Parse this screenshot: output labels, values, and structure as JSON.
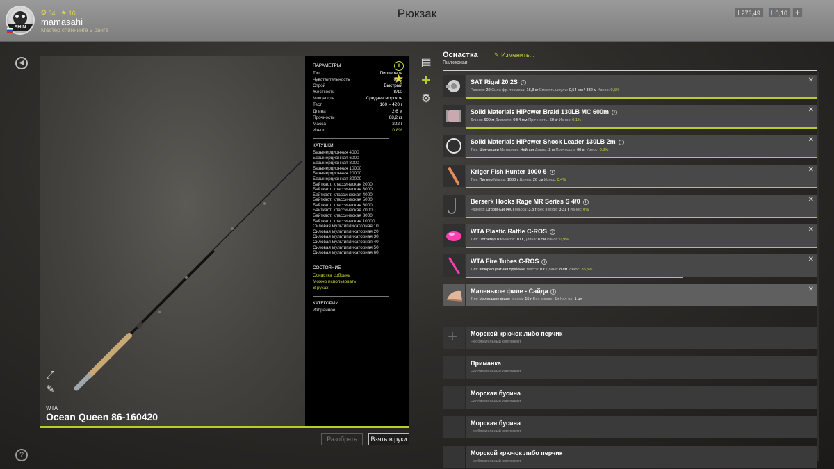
{
  "header": {
    "title": "Рюкзак",
    "user": {
      "name": "mamasahi",
      "subtitle": "Мастер спиннинга 2 ранга",
      "level": "34",
      "stars": "16",
      "avatar_text": "SHIN"
    },
    "currency": [
      {
        "icon": "silver-coin-icon",
        "value": "273,49"
      },
      {
        "icon": "gold-coin-icon",
        "value": "0,10"
      }
    ],
    "plus_label": "+"
  },
  "rod": {
    "brand": "WTA",
    "name": "Ocean Queen 86-160420",
    "durability_percent": 100,
    "params_title": "ПАРАМЕТРЫ",
    "params": [
      {
        "label": "Тип",
        "value": "Пилкерное"
      },
      {
        "label": "Чувствительность",
        "value": "6/10"
      },
      {
        "label": "Строй",
        "value": "Быстрый"
      },
      {
        "label": "Жёсткость",
        "value": "8/10"
      },
      {
        "label": "Мощность",
        "value": "Среднее морское"
      },
      {
        "label": "Тест",
        "value": "160 – 420 г"
      },
      {
        "label": "Длина",
        "value": "2,6 м"
      },
      {
        "label": "Прочность",
        "value": "68,2 кг"
      },
      {
        "label": "Масса",
        "value": "202 г"
      },
      {
        "label": "Износ",
        "value": "0,8%"
      }
    ],
    "reels_title": "КАТУШКИ",
    "reels": [
      "Безынерционная 4000",
      "Безынерционная 6000",
      "Безынерционная 8000",
      "Безынерционная 10000",
      "Безынерционная 20000",
      "Безынерционная 30000",
      "Байткаст. классическая 2000",
      "Байткаст. классическая 3000",
      "Байткаст. классическая 4000",
      "Байткаст. классическая 5000",
      "Байткаст. классическая 6000",
      "Байткаст. классическая 7000",
      "Байткаст. классическая 8000",
      "Байткаст. классическая 10000",
      "Силовая мультипликаторная 10",
      "Силовая мультипликаторная 20",
      "Силовая мультипликаторная 30",
      "Силовая мультипликаторная 40",
      "Силовая мультипликаторная 50",
      "Силовая мультипликаторная 60"
    ],
    "state_title": "СОСТОЯНИЕ",
    "states": [
      "Оснастка собрана",
      "Можно использовать",
      "В руках"
    ],
    "categories_title": "КАТЕГОРИИ",
    "categories": [
      "Избранное"
    ],
    "buttons": {
      "disassemble": "Разобрать",
      "take": "Взять в руки"
    }
  },
  "tackle": {
    "title": "Оснастка",
    "subtitle": "Пилкерная",
    "edit_label": "Изменить...",
    "items": [
      {
        "name": "SAT Rigal 20 2S",
        "icon": "reel-icon",
        "wear": 1.0,
        "details": [
          [
            "Размер:",
            "20"
          ],
          [
            "Сила фр. тормоза:",
            "16,3 кг"
          ],
          [
            "Ёмкость шпули:",
            "0,54 мм / 332 м"
          ],
          [
            "Износ:",
            "0,5%"
          ]
        ]
      },
      {
        "name": "Solid Materials HiPower Braid 130LB MC 600m",
        "icon": "braid-spool-icon",
        "wear": 1.0,
        "details": [
          [
            "Длина:",
            "600 м"
          ],
          [
            "Диаметр:",
            "0,54 мм"
          ],
          [
            "Прочность:",
            "60 кг"
          ],
          [
            "Износ:",
            "0,1%"
          ]
        ]
      },
      {
        "name": "Solid Materials HiPower Shock Leader 130LB 2m",
        "icon": "leader-coil-icon",
        "wear": 1.0,
        "details": [
          [
            "Тип:",
            "Шок-лидер"
          ],
          [
            "Материал:",
            "Нейлон"
          ],
          [
            "Длина:",
            "2 м"
          ],
          [
            "Прочность:",
            "60 кг"
          ],
          [
            "Износ:",
            "0,8%"
          ]
        ]
      },
      {
        "name": "Kriger Fish Hunter 1000-5",
        "icon": "pilker-icon",
        "wear": 1.0,
        "details": [
          [
            "Тип:",
            "Пилкер"
          ],
          [
            "Масса:",
            "1000 г"
          ],
          [
            "Длина:",
            "26 см"
          ],
          [
            "Износ:",
            "0,4%"
          ]
        ]
      },
      {
        "name": "Berserk Hooks Rage MR Series S 4/0",
        "icon": "hook-icon",
        "wear": 1.0,
        "details": [
          [
            "Размер:",
            "Огромный (4/0)"
          ],
          [
            "Масса:",
            "3,8 г"
          ],
          [
            "Вес в воде:",
            "3,31 г"
          ],
          [
            "Износ:",
            "0%"
          ]
        ]
      },
      {
        "name": "WTA Plastic Rattle C-ROS",
        "icon": "rattle-icon",
        "wear": 1.0,
        "details": [
          [
            "Тип:",
            "Погремушка"
          ],
          [
            "Масса:",
            "10 г"
          ],
          [
            "Длина:",
            "8 см"
          ],
          [
            "Износ:",
            "0,9%"
          ]
        ]
      },
      {
        "name": "WTA Fire Tubes C-ROS",
        "icon": "fire-tube-icon",
        "wear": 0.62,
        "details": [
          [
            "Тип:",
            "Флюресцентная трубочка"
          ],
          [
            "Масса:",
            "0 г"
          ],
          [
            "Длина:",
            "8 см"
          ],
          [
            "Износ:",
            "35,5%"
          ]
        ]
      },
      {
        "name": "Маленькое филе - Сайда",
        "icon": "fish-fillet-icon",
        "wear": null,
        "highlight": true,
        "details": [
          [
            "Тип:",
            "Маленькое филе"
          ],
          [
            "Масса:",
            "15 г"
          ],
          [
            "Вес в воде:",
            "5 г"
          ],
          [
            "Кол-во:",
            "1 шт"
          ]
        ]
      }
    ],
    "optional_note": "Необязательный компонент",
    "optional_slots": [
      {
        "name": "Морской крючок либо перчик",
        "show_plus": true
      },
      {
        "name": "Приманка"
      },
      {
        "name": "Морская бусина"
      },
      {
        "name": "Морская бусина"
      },
      {
        "name": "Морской крючок либо перчик"
      }
    ]
  },
  "colors": {
    "accent": "#b9cc2e",
    "star": "#e8d43c"
  }
}
